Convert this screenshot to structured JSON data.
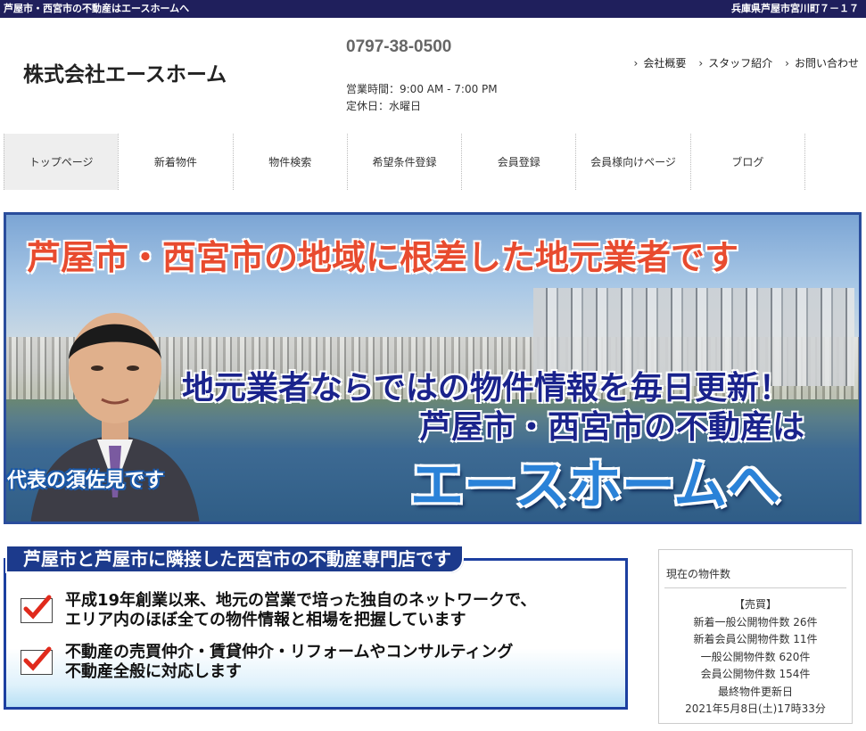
{
  "topbar": {
    "left": "芦屋市・西宮市の不動産はエースホームへ",
    "right": "兵庫県芦屋市宮川町７－１７"
  },
  "header": {
    "company": "株式会社エースホーム",
    "phone": "0797-38-0500",
    "hours": "営業時間：9:00 AM - 7:00 PM",
    "holiday": "定休日：水曜日",
    "links": [
      "会社概要",
      "スタッフ紹介",
      "お問い合わせ"
    ]
  },
  "nav": [
    "トップページ",
    "新着物件",
    "物件検索",
    "希望条件登録",
    "会員登録",
    "会員様向けページ",
    "ブログ"
  ],
  "hero": {
    "headline": "芦屋市・西宮市の地域に根差した地元業者です",
    "line2": "地元業者ならではの物件情報を毎日更新！",
    "line3": "芦屋市・西宮市の不動産は",
    "line4": "エースホームへ",
    "representative": "代表の須佐見です"
  },
  "intro": {
    "title": "芦屋市と芦屋市に隣接した西宮市の不動産専門店です",
    "points": [
      {
        "l1": "平成19年創業以来、地元の営業で培った独自のネットワークで、",
        "l2": "エリア内のほぼ全ての物件情報と相場を把握しています"
      },
      {
        "l1": "不動産の売買仲介・賃貸仲介・リフォームやコンサルティング",
        "l2": "不動産全般に対応します"
      }
    ]
  },
  "stats": {
    "heading": "現在の物件数",
    "section": "【売買】",
    "lines": [
      "新着一般公開物件数 26件",
      "新着会員公開物件数 11件",
      "一般公開物件数 620件",
      "会員公開物件数 154件",
      "最終物件更新日",
      "2021年5月8日(土)17時33分"
    ]
  },
  "colors": {
    "topbar": "#1f1f5c",
    "accent_red": "#e84b2f",
    "navy_text": "#1a238c",
    "brand_blue": "#2a82d8"
  }
}
